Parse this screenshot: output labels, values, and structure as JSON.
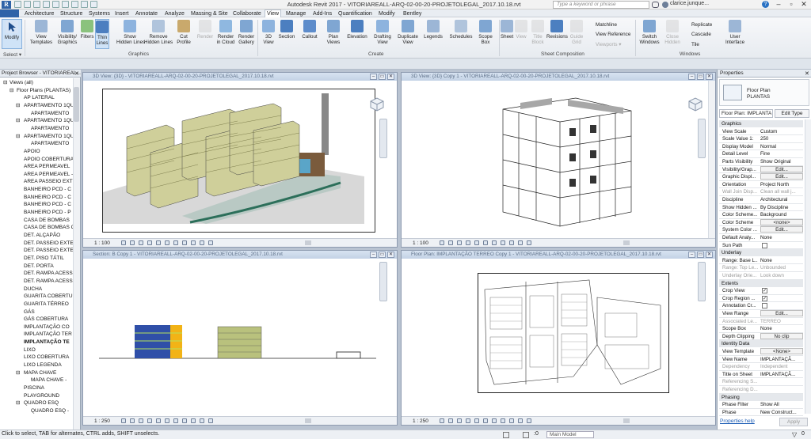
{
  "app": {
    "title": "Autodesk Revit 2017 -   VITORIAREALL-ARQ-02-00-20-PROJETOLEGAL_2017.10.18.rvt",
    "search_placeholder": "Type a keyword or phrase",
    "user": "clarice.junque...",
    "accent": "#2b6cb0"
  },
  "menu": [
    "Architecture",
    "Structure",
    "Systems",
    "Insert",
    "Annotate",
    "Analyze",
    "Massing & Site",
    "Collaborate",
    "View",
    "Manage",
    "Add-Ins",
    "Quantification",
    "Modify",
    "Bentley"
  ],
  "menu_active": "View",
  "ribbon": {
    "select_label": "Select ▾",
    "modify": "Modify",
    "graphics_buttons": [
      "View\nTemplates",
      "Visibility/\nGraphics",
      "Filters",
      "Thin\nLines",
      "Show\nHidden Lines",
      "Remove\nHidden Lines",
      "Cut\nProfile",
      "Render",
      "Render\nin Cloud",
      "Render\nGallery"
    ],
    "create_buttons": [
      "3D\nView",
      "Section",
      "Callout",
      "Plan\nViews",
      "Elevation",
      "Drafting\nView",
      "Duplicate\nView",
      "Legends",
      "Schedules",
      "Scope\nBox"
    ],
    "sheet_buttons": [
      "Sheet",
      "View",
      "Title\nBlock",
      "Revisions",
      "Guide\nGrid"
    ],
    "sheet_small": [
      "Matchline",
      "View Reference",
      "Viewports ▾"
    ],
    "window_buttons": [
      "Switch\nWindows",
      "Close\nHidden",
      "User\nInterface"
    ],
    "window_small": [
      "Replicate",
      "Cascade",
      "Tile"
    ],
    "panels": {
      "graphics": "Graphics",
      "create": "Create",
      "sheet": "Sheet Composition",
      "windows": "Windows"
    }
  },
  "project_browser": {
    "title": "Project Browser - VITORIAREAL...",
    "items": [
      {
        "label": "Views (all)",
        "level": 0,
        "expander": "⊟"
      },
      {
        "label": "Floor Plans (PLANTAS)",
        "level": 1,
        "expander": "⊟"
      },
      {
        "label": "AP LATERAL",
        "level": 2
      },
      {
        "label": "APARTAMENTO 1QU",
        "level": 2,
        "expander": "⊟"
      },
      {
        "label": "APARTAMENTO",
        "level": 3
      },
      {
        "label": "APARTAMENTO 1QU",
        "level": 2,
        "expander": "⊟"
      },
      {
        "label": "APARTAMENTO",
        "level": 3
      },
      {
        "label": "APARTAMENTO 1QU",
        "level": 2,
        "expander": "⊟"
      },
      {
        "label": "APARTAMENTO",
        "level": 3
      },
      {
        "label": "APOIO",
        "level": 2
      },
      {
        "label": "APOIO COBERTURA",
        "level": 2
      },
      {
        "label": "AREA PERMEAVEL",
        "level": 2
      },
      {
        "label": "AREA PERMEAVEL -",
        "level": 2
      },
      {
        "label": "AREA PASSEIO EXT",
        "level": 2
      },
      {
        "label": "BANHEIRO PCD - C",
        "level": 2
      },
      {
        "label": "BANHEIRO PCD - C",
        "level": 2
      },
      {
        "label": "BANHEIRO PCD - C",
        "level": 2
      },
      {
        "label": "BANHEIRO PCD - P",
        "level": 2
      },
      {
        "label": "CASA DE BOMBAS",
        "level": 2
      },
      {
        "label": "CASA DE BOMBAS C",
        "level": 2
      },
      {
        "label": "DET. ALÇAPÃO",
        "level": 2
      },
      {
        "label": "DET. PASSEIO EXTE",
        "level": 2
      },
      {
        "label": "DET. PASSEIO EXTE",
        "level": 2
      },
      {
        "label": "DET. PISO TÁTIL",
        "level": 2
      },
      {
        "label": "DET. PORTA",
        "level": 2
      },
      {
        "label": "DET. RAMPA ACESS",
        "level": 2
      },
      {
        "label": "DET. RAMPA ACESS",
        "level": 2
      },
      {
        "label": "DUCHA",
        "level": 2
      },
      {
        "label": "GUARITA COBERTUR",
        "level": 2
      },
      {
        "label": "GUARITA TÉRREO",
        "level": 2
      },
      {
        "label": "GÁS",
        "level": 2
      },
      {
        "label": "GÁS COBERTURA",
        "level": 2
      },
      {
        "label": "IMPLANTAÇÃO CO",
        "level": 2
      },
      {
        "label": "IMPLANTAÇÃO TER",
        "level": 2
      },
      {
        "label": "IMPLANTAÇÃO TE",
        "level": 2,
        "bold": true
      },
      {
        "label": "LIXO",
        "level": 2
      },
      {
        "label": "LIXO COBERTURA",
        "level": 2
      },
      {
        "label": "LIXO LEGENDA",
        "level": 2
      },
      {
        "label": "MAPA CHAVE",
        "level": 2,
        "expander": "⊟"
      },
      {
        "label": "MAPA CHAVE -",
        "level": 3
      },
      {
        "label": "PISCINA",
        "level": 2
      },
      {
        "label": "PLAYGROUND",
        "level": 2
      },
      {
        "label": "QUADRO ESQ",
        "level": 2,
        "expander": "⊟"
      },
      {
        "label": "QUADRO ESQ -",
        "level": 3
      }
    ]
  },
  "viewports": [
    {
      "title": "3D View: {3D} - VITORIAREALL-ARQ-02-00-20-PROJETOLEGAL_2017.10.18.rvt",
      "scale": "1 : 100"
    },
    {
      "title": "3D View: {3D} Copy 1 - VITORIAREALL-ARQ-02-00-20-PROJETOLEGAL_2017.10.18.rvt",
      "scale": "1 : 100"
    },
    {
      "title": "Section: B Copy 1 - VITORIAREALL-ARQ-02-00-20-PROJETOLEGAL_2017.10.18.rvt",
      "scale": "1 : 250"
    },
    {
      "title": "Floor Plan: IMPLANTAÇÃO TERREO Copy 1 - VITORIAREALL-ARQ-02-00-20-PROJETOLEGAL_2017.10.18.rvt",
      "scale": "1 : 250"
    }
  ],
  "properties": {
    "title": "Properties",
    "type_name": "Floor Plan\nPLANTAS",
    "selector": "Floor Plan: IMPLANTA",
    "edit_type": "Edit Type",
    "sections": [
      {
        "name": "Graphics",
        "rows": [
          {
            "k": "View Scale",
            "v": "Custom",
            "kind": "input"
          },
          {
            "k": "Scale Value  1:",
            "v": "250",
            "kind": "input"
          },
          {
            "k": "Display Model",
            "v": "Normal"
          },
          {
            "k": "Detail Level",
            "v": "Fine"
          },
          {
            "k": "Parts Visibility",
            "v": "Show Original"
          },
          {
            "k": "Visibility/Grap...",
            "v": "Edit...",
            "kind": "btn"
          },
          {
            "k": "Graphic Displ...",
            "v": "Edit...",
            "kind": "btn"
          },
          {
            "k": "Orientation",
            "v": "Project North"
          },
          {
            "k": "Wall Join Disp...",
            "v": "Clean all wall j...",
            "gray": true
          },
          {
            "k": "Discipline",
            "v": "Architectural"
          },
          {
            "k": "Show Hidden ...",
            "v": "By Discipline"
          },
          {
            "k": "Color Scheme...",
            "v": "Background"
          },
          {
            "k": "Color Scheme",
            "v": "<none>",
            "kind": "btn"
          },
          {
            "k": "System Color ...",
            "v": "Edit...",
            "kind": "btn"
          },
          {
            "k": "Default Analy...",
            "v": "None"
          },
          {
            "k": "Sun Path",
            "v": "",
            "kind": "chk"
          }
        ]
      },
      {
        "name": "Underlay",
        "rows": [
          {
            "k": "Range: Base L...",
            "v": "None"
          },
          {
            "k": "Range: Top Le...",
            "v": "Unbounded",
            "gray": true
          },
          {
            "k": "Underlay Orie...",
            "v": "Look down",
            "gray": true
          }
        ]
      },
      {
        "name": "Extents",
        "rows": [
          {
            "k": "Crop View",
            "v": "✓",
            "kind": "chk"
          },
          {
            "k": "Crop Region ...",
            "v": "✓",
            "kind": "chk"
          },
          {
            "k": "Annotation Cr...",
            "v": "",
            "kind": "chk"
          },
          {
            "k": "View Range",
            "v": "Edit...",
            "kind": "btn"
          },
          {
            "k": "Associated Le...",
            "v": "TERREO",
            "gray": true
          },
          {
            "k": "Scope Box",
            "v": "None"
          },
          {
            "k": "Depth Clipping",
            "v": "No clip",
            "kind": "btn"
          }
        ]
      },
      {
        "name": "Identity Data",
        "rows": [
          {
            "k": "View Template",
            "v": "<None>",
            "kind": "btn"
          },
          {
            "k": "View Name",
            "v": "IMPLANTAÇÃ..."
          },
          {
            "k": "Dependency",
            "v": "Independent",
            "gray": true
          },
          {
            "k": "Title on Sheet",
            "v": "IMPLANTAÇÃ..."
          },
          {
            "k": "Referencing S...",
            "v": "",
            "gray": true
          },
          {
            "k": "Referencing D...",
            "v": "",
            "gray": true
          }
        ]
      },
      {
        "name": "Phasing",
        "rows": [
          {
            "k": "Phase Filter",
            "v": "Show All"
          },
          {
            "k": "Phase",
            "v": "New Construct..."
          }
        ]
      }
    ],
    "help_link": "Properties help",
    "apply": "Apply"
  },
  "status": {
    "text": "Click to select, TAB for alternates, CTRL adds, SHIFT unselects.",
    "model": "Main Model",
    "zoom": ":0"
  }
}
